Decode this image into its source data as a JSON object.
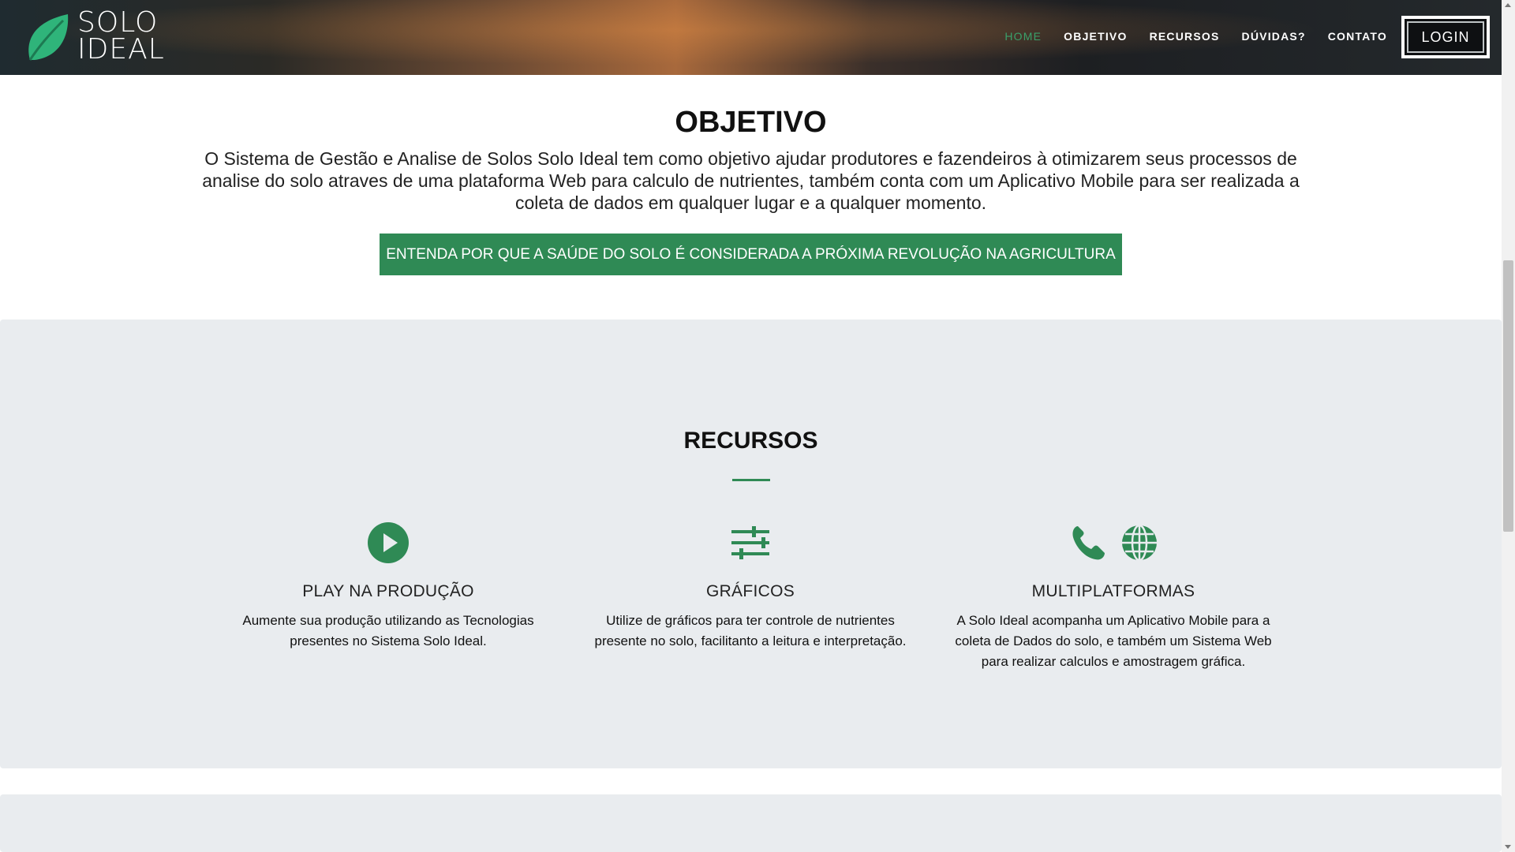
{
  "header": {
    "logo_line1": "SOLO",
    "logo_line2": "IDEAL",
    "nav": [
      "HOME",
      "OBJETIVO",
      "RECURSOS",
      "DÚVIDAS?",
      "CONTATO"
    ],
    "active": "HOME",
    "login_label": "LOGIN"
  },
  "objetivo": {
    "title": "OBJETIVO",
    "text": "O Sistema de Gestão e Analise de Solos Solo Ideal tem como objetivo ajudar produtores e fazendeiros à otimizarem seus processos de analise do solo atraves de uma plataforma Web para calculo de nutrientes, também conta com um Aplicativo Mobile para ser realizada a coleta de dados em qualquer lugar e a qualquer momento.",
    "cta_label": "ENTENDA POR QUE A SAÚDE DO SOLO É CONSIDERADA A PRÓXIMA REVOLUÇÃO NA AGRICULTURA"
  },
  "recursos": {
    "title": "RECURSOS",
    "features": [
      {
        "icon": "play-circle-icon",
        "title": "PLAY NA PRODUÇÃO",
        "desc": "Aumente sua produção utilizando as Tecnologias presentes no Sistema Solo Ideal."
      },
      {
        "icon": "sliders-icon",
        "title": "GRÁFICOS",
        "desc": "Utilize de gráficos para ter controle de nutrientes presente no solo, facilitanto a leitura e interpretação."
      },
      {
        "icon": "phone-globe-icon",
        "title": "MULTIPLATFORMAS",
        "desc": "A Solo Ideal acompanha um Aplicativo Mobile para a coleta de Dados do solo, e também um Sistema Web para realizar calculos e amostragem gráfica."
      }
    ]
  },
  "colors": {
    "accent": "#2f8a55",
    "section_bg": "#e9ecef",
    "nav_active": "#3aa06a"
  }
}
